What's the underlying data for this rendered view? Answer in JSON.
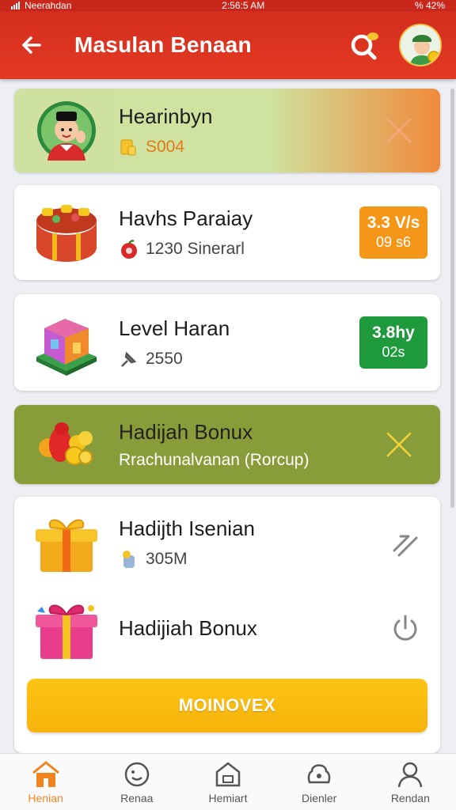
{
  "status_bar": {
    "carrier": "Neerahdan",
    "time": "2:56:5 AM",
    "battery": "% 42%"
  },
  "header": {
    "title": "Masulan Benaan"
  },
  "cards": [
    {
      "title": "Hearinbyn",
      "subtitle": "S004",
      "bg": [
        "#cfe1a0",
        "#f08a3a"
      ]
    },
    {
      "title": "Havhs Paraiay",
      "subtitle": "1230 Sinerarl",
      "badge_top": "3.3 V/s",
      "badge_bottom": "09 s6",
      "badge_color": "#f49719"
    },
    {
      "title": "Level Haran",
      "subtitle": "2550",
      "badge_top": "3.8hy",
      "badge_bottom": "02s",
      "badge_color": "#1e9a3c"
    },
    {
      "title": "Hadijah Bonux",
      "subtitle": "Rrachunalvanan (Rorcup)",
      "bg": "#889d3a"
    },
    {
      "title": "Hadijth Isenian",
      "subtitle": "305M"
    },
    {
      "title": "Hadijiah Bonux"
    }
  ],
  "cta": {
    "label": "MOINOVEX"
  },
  "bottom_nav": [
    {
      "label": "Henian",
      "icon": "home-icon",
      "active": true
    },
    {
      "label": "Renaa",
      "icon": "smiley-icon",
      "active": false
    },
    {
      "label": "Hemiart",
      "icon": "store-icon",
      "active": false
    },
    {
      "label": "Dienler",
      "icon": "bag-icon",
      "active": false
    },
    {
      "label": "Rendan",
      "icon": "profile-icon",
      "active": false
    }
  ],
  "colors": {
    "header": "#d42d1f",
    "accent": "#f0841f",
    "cta": "#f7b30b"
  }
}
